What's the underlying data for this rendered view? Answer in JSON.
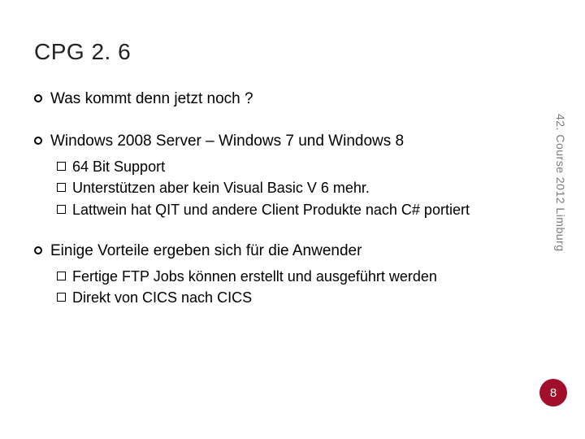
{
  "title": "CPG 2. 6",
  "bullets": {
    "b1": "Was kommt denn jetzt noch ?",
    "b2": "Windows 2008 Server – Windows 7 und  Windows 8",
    "b2_sub": {
      "s1": "64 Bit Support",
      "s2": "Unterstützen  aber kein Visual Basic V 6 mehr.",
      "s3": "Lattwein hat QIT und andere Client Produkte nach C# portiert"
    },
    "b3": "Einige Vorteile ergeben sich für die Anwender",
    "b3_sub": {
      "s1": "Fertige FTP Jobs können erstellt und ausgeführt werden",
      "s2": "Direkt von CICS nach CICS"
    }
  },
  "side_text": "42. Course 2012  Limburg",
  "page_number": "8",
  "colors": {
    "badge": "#a10f2b",
    "side_text": "#7a7a7a"
  }
}
